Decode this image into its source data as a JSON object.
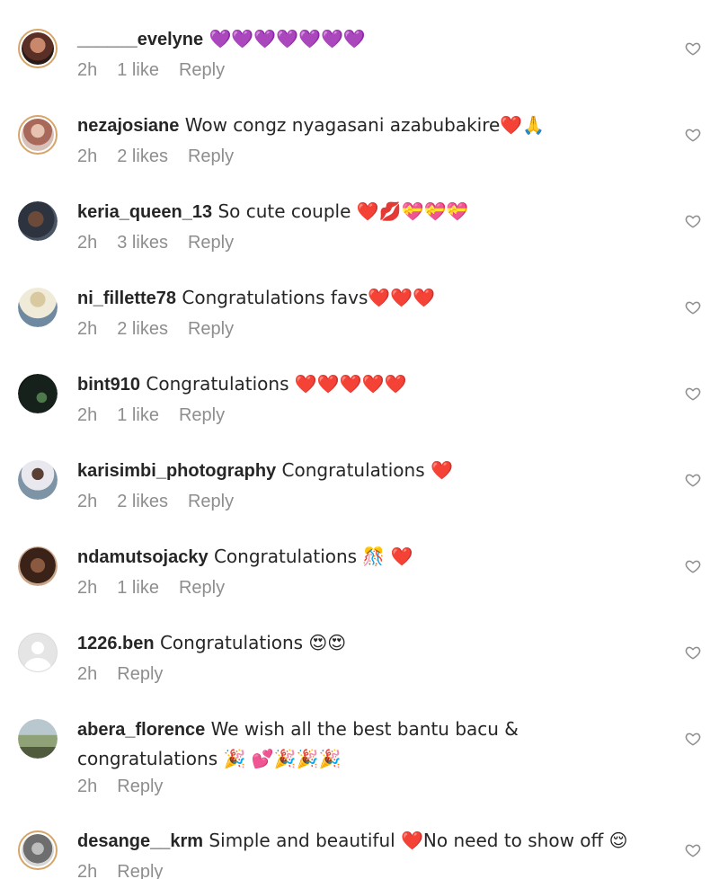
{
  "comments": [
    {
      "username": "______evelyne",
      "text": " 💜💜💜💜💜💜💜",
      "time": "2h",
      "likes": "1 like",
      "reply": "Reply",
      "avatar": "photo-person-sunglasses",
      "avatar_color": "#7a4a3a"
    },
    {
      "username": "nezajosiane",
      "text": " Wow congz nyagasani azabubakire❤️🙏",
      "time": "2h",
      "likes": "2 likes",
      "reply": "Reply",
      "avatar": "photo-person",
      "avatar_color": "#b98a7c"
    },
    {
      "username": "keria_queen_13",
      "text": " So cute couple ❤️💋💝💝💝",
      "time": "2h",
      "likes": "3 likes",
      "reply": "Reply",
      "avatar": "photo-person-dark",
      "avatar_color": "#3a3f4a"
    },
    {
      "username": "ni_fillette78",
      "text": " Congratulations favs❤️❤️❤️",
      "time": "2h",
      "likes": "2 likes",
      "reply": "Reply",
      "avatar": "photo-person-hat",
      "avatar_color": "#c8b89a"
    },
    {
      "username": "bint910",
      "text": " Congratulations ❤️❤️❤️❤️❤️",
      "time": "2h",
      "likes": "1 like",
      "reply": "Reply",
      "avatar": "photo-night",
      "avatar_color": "#1f2a24"
    },
    {
      "username": "karisimbi_photography",
      "text": " Congratulations ❤️",
      "time": "2h",
      "likes": "2 likes",
      "reply": "Reply",
      "avatar": "photo-person-outdoor",
      "avatar_color": "#8a9aa8"
    },
    {
      "username": "ndamutsojacky",
      "text": " Congratulations 🎊 ❤️",
      "time": "2h",
      "likes": "1 like",
      "reply": "Reply",
      "avatar": "photo-person-braids",
      "avatar_color": "#5a3a2e"
    },
    {
      "username": "1226.ben",
      "text": " Congratulations 😍😍",
      "time": "2h",
      "likes": "",
      "reply": "Reply",
      "avatar": "default-avatar",
      "avatar_color": "#e5e5e5"
    },
    {
      "username": "abera_florence",
      "text": " We wish all the best bantu bacu & congratulations 🎉 💕🎉🎉🎉",
      "time": "2h",
      "likes": "",
      "reply": "Reply",
      "avatar": "photo-landscape-person",
      "avatar_color": "#9aa58a"
    },
    {
      "username": "desange__krm",
      "text": " Simple and beautiful ❤️No need to show off 😌",
      "time": "2h",
      "likes": "",
      "reply": "Reply",
      "avatar": "photo-person-bw",
      "avatar_color": "#8d8d8d"
    }
  ],
  "icons": {
    "like": "heart-outline-icon"
  },
  "colors": {
    "text_primary": "#262626",
    "text_secondary": "#8e8e8e",
    "story_ring": "#d6a56a",
    "background": "#ffffff"
  }
}
